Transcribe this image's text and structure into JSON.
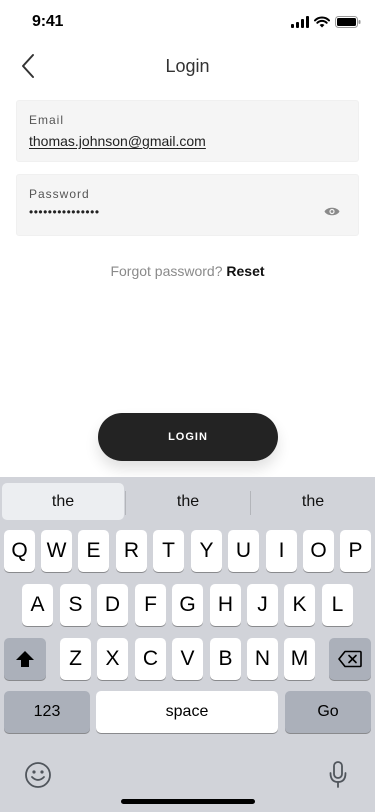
{
  "status": {
    "time": "9:41"
  },
  "nav": {
    "title": "Login"
  },
  "email": {
    "label": "Email",
    "value": "thomas.johnson@gmail.com"
  },
  "password": {
    "label": "Password",
    "value": "•••••••••••••••"
  },
  "forgot": {
    "text": "Forgot password?",
    "link": "Reset"
  },
  "login_button": "LOGIN",
  "keyboard": {
    "suggestions": [
      "the",
      "the",
      "the"
    ],
    "row1": [
      "Q",
      "W",
      "E",
      "R",
      "T",
      "Y",
      "U",
      "I",
      "O",
      "P"
    ],
    "row2": [
      "A",
      "S",
      "D",
      "F",
      "G",
      "H",
      "J",
      "K",
      "L"
    ],
    "row3": [
      "Z",
      "X",
      "C",
      "V",
      "B",
      "N",
      "M"
    ],
    "numbers_label": "123",
    "space_label": "space",
    "go_label": "Go"
  },
  "colors": {
    "button": "#232323",
    "field_bg": "#f5f5f5",
    "keyboard_bg": "#d1d3d9",
    "key_dark": "#abb0ba"
  },
  "icons": [
    "signal-icon",
    "wifi-icon",
    "battery-icon",
    "back-chevron-icon",
    "eye-icon",
    "shift-icon",
    "backspace-icon",
    "emoji-icon",
    "microphone-icon"
  ]
}
